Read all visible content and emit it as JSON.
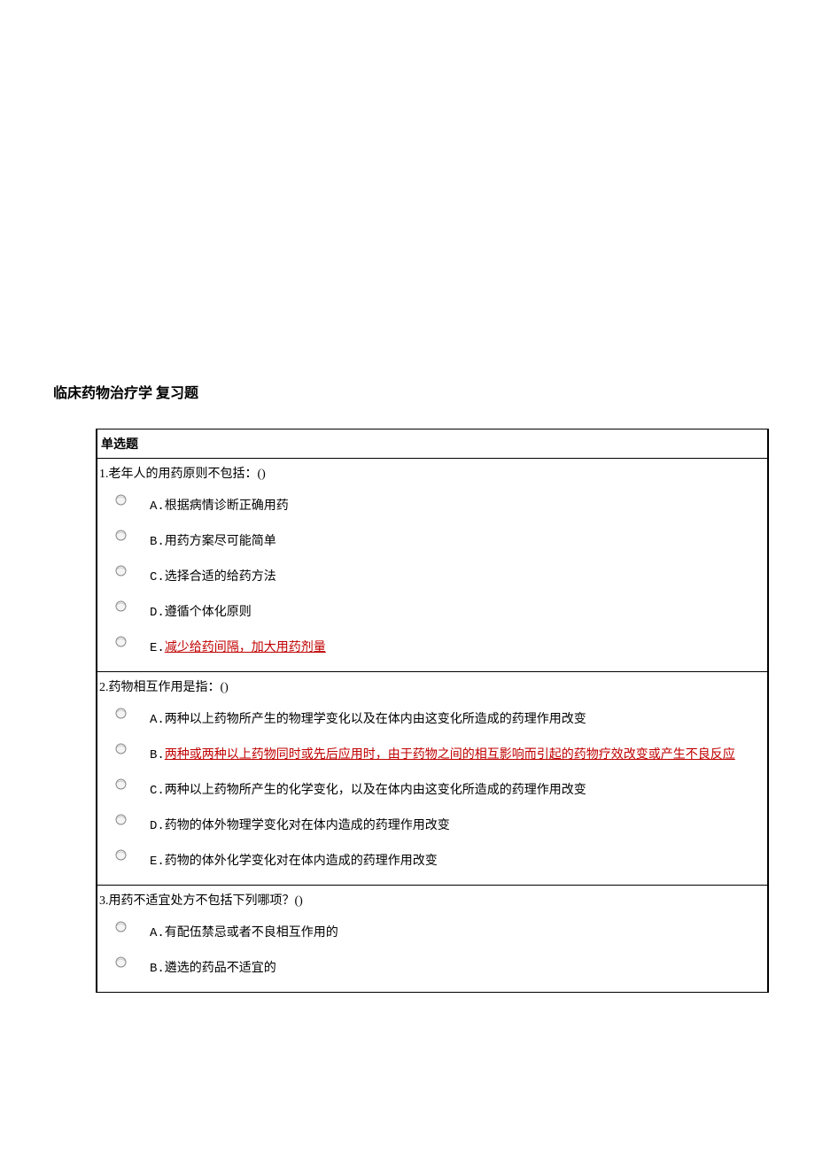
{
  "title": "临床药物治疗学 复习题",
  "section_header": "单选题",
  "questions": [
    {
      "num": "1.",
      "stem": "老年人的用药原则不包括：()",
      "options": [
        {
          "label": "A.根据病情诊断正确用药",
          "is_answer": false
        },
        {
          "label": "B.用药方案尽可能简单",
          "is_answer": false
        },
        {
          "label": "C.选择合适的给药方法",
          "is_answer": false
        },
        {
          "label": "D.遵循个体化原则",
          "is_answer": false
        },
        {
          "label": "E.减少给药间隔，加大用药剂量",
          "is_answer": true,
          "prefix": "E.",
          "ans": "减少给药间隔，加大用药剂量"
        }
      ]
    },
    {
      "num": "2.",
      "stem": "药物相互作用是指：()",
      "options": [
        {
          "label": "A.两种以上药物所产生的物理学变化以及在体内由这变化所造成的药理作用改变",
          "is_answer": false
        },
        {
          "label": "B.两种或两种以上药物同时或先后应用时，由于药物之间的相互影响而引起的药物疗效改变或产生不良反应",
          "is_answer": true,
          "prefix": "B.",
          "ans": "两种或两种以上药物同时或先后应用时，由于药物之间的相互影响而引起的药物疗效改变或产生不良反应"
        },
        {
          "label": "C.两种以上药物所产生的化学变化，以及在体内由这变化所造成的药理作用改变",
          "is_answer": false
        },
        {
          "label": "D.药物的体外物理学变化对在体内造成的药理作用改变",
          "is_answer": false
        },
        {
          "label": "E.药物的体外化学变化对在体内造成的药理作用改变",
          "is_answer": false
        }
      ]
    },
    {
      "num": "3.",
      "stem": "用药不适宜处方不包括下列哪项？()",
      "options": [
        {
          "label": "A.有配伍禁忌或者不良相互作用的",
          "is_answer": false
        },
        {
          "label": "B.遴选的药品不适宜的",
          "is_answer": false
        }
      ]
    }
  ]
}
